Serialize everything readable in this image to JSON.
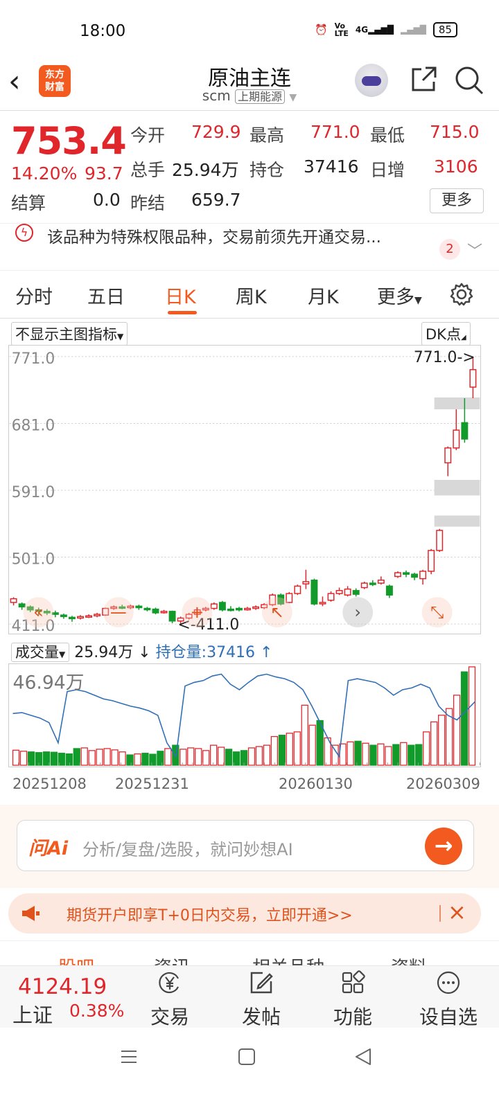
{
  "status_bar": {
    "time": "18:00",
    "battery": "85",
    "network": "4G"
  },
  "header": {
    "logo_line1": "东方",
    "logo_line2": "财富",
    "title": "原油主连",
    "code": "scm",
    "exchange": "上期能源"
  },
  "quote": {
    "price": "753.4",
    "change_pct": "14.20%",
    "change": "93.7",
    "fields": [
      {
        "label": "今开",
        "value": "729.9"
      },
      {
        "label": "最高",
        "value": "771.0"
      },
      {
        "label": "最低",
        "value": "715.0"
      },
      {
        "label": "总手",
        "value": "25.94万"
      },
      {
        "label": "持仓",
        "value": "37416"
      },
      {
        "label": "日增",
        "value": "3106"
      },
      {
        "label": "结算",
        "value": "0.0"
      },
      {
        "label": "昨结",
        "value": "659.7"
      }
    ],
    "more_label": "更多"
  },
  "notice": {
    "text": "该品种为特殊权限品种，交易前须先开通交易...",
    "count": "2"
  },
  "tabs": [
    "分时",
    "五日",
    "日K",
    "周K",
    "月K",
    "更多"
  ],
  "active_tab": "日K",
  "indicator": {
    "main_selector": "不显示主图指标",
    "dk_label": "DK点"
  },
  "volume_header": {
    "selector": "成交量",
    "volume": "25.94万",
    "volume_arrow": "↓",
    "oi": "持仓量:37416",
    "oi_arrow": "↑"
  },
  "chart_data": {
    "type": "candlestick",
    "y_ticks": [
      "771.0",
      "681.0",
      "591.0",
      "501.0",
      "411.0"
    ],
    "ylim": [
      411.0,
      771.0
    ],
    "max_label": "771.0->",
    "min_label": "<-411.0",
    "x_ticks": [
      "20251208",
      "20251231",
      "20260130",
      "20260309"
    ],
    "volume_max_label": "46.94万",
    "candles": [
      {
        "o": 440,
        "c": 445,
        "h": 447,
        "l": 436,
        "up": true
      },
      {
        "o": 438,
        "c": 434,
        "h": 440,
        "l": 430,
        "up": false
      },
      {
        "o": 434,
        "c": 430,
        "h": 436,
        "l": 427,
        "up": false
      },
      {
        "o": 430,
        "c": 428,
        "h": 433,
        "l": 422,
        "up": false
      },
      {
        "o": 428,
        "c": 426,
        "h": 431,
        "l": 423,
        "up": false
      },
      {
        "o": 426,
        "c": 424,
        "h": 429,
        "l": 420,
        "up": false
      },
      {
        "o": 423,
        "c": 421,
        "h": 425,
        "l": 418,
        "up": false
      },
      {
        "o": 420,
        "c": 419,
        "h": 422,
        "l": 414,
        "up": false
      },
      {
        "o": 419,
        "c": 421,
        "h": 423,
        "l": 417,
        "up": true
      },
      {
        "o": 421,
        "c": 422,
        "h": 424,
        "l": 419,
        "up": true
      },
      {
        "o": 422,
        "c": 424,
        "h": 426,
        "l": 420,
        "up": true
      },
      {
        "o": 423,
        "c": 432,
        "h": 433,
        "l": 422,
        "up": true
      },
      {
        "o": 432,
        "c": 434,
        "h": 436,
        "l": 430,
        "up": true
      },
      {
        "o": 434,
        "c": 433,
        "h": 437,
        "l": 431,
        "up": false
      },
      {
        "o": 433,
        "c": 435,
        "h": 437,
        "l": 431,
        "up": true
      },
      {
        "o": 435,
        "c": 433,
        "h": 437,
        "l": 430,
        "up": false
      },
      {
        "o": 432,
        "c": 431,
        "h": 434,
        "l": 428,
        "up": false
      },
      {
        "o": 431,
        "c": 426,
        "h": 433,
        "l": 424,
        "up": false
      },
      {
        "o": 427,
        "c": 428,
        "h": 430,
        "l": 425,
        "up": true
      },
      {
        "o": 428,
        "c": 415,
        "h": 429,
        "l": 412,
        "up": false
      },
      {
        "o": 415,
        "c": 419,
        "h": 421,
        "l": 411,
        "up": true
      },
      {
        "o": 419,
        "c": 424,
        "h": 426,
        "l": 417,
        "up": true
      },
      {
        "o": 424,
        "c": 430,
        "h": 432,
        "l": 422,
        "up": true
      },
      {
        "o": 430,
        "c": 432,
        "h": 434,
        "l": 428,
        "up": true
      },
      {
        "o": 432,
        "c": 438,
        "h": 440,
        "l": 430,
        "up": true
      },
      {
        "o": 440,
        "c": 430,
        "h": 442,
        "l": 428,
        "up": false
      },
      {
        "o": 431,
        "c": 431,
        "h": 435,
        "l": 428,
        "up": false
      },
      {
        "o": 432,
        "c": 430,
        "h": 434,
        "l": 428,
        "up": false
      },
      {
        "o": 431,
        "c": 432,
        "h": 434,
        "l": 429,
        "up": true
      },
      {
        "o": 432,
        "c": 434,
        "h": 436,
        "l": 430,
        "up": true
      },
      {
        "o": 433,
        "c": 437,
        "h": 439,
        "l": 431,
        "up": true
      },
      {
        "o": 437,
        "c": 450,
        "h": 452,
        "l": 435,
        "up": true
      },
      {
        "o": 450,
        "c": 438,
        "h": 452,
        "l": 436,
        "up": false
      },
      {
        "o": 440,
        "c": 452,
        "h": 454,
        "l": 439,
        "up": true
      },
      {
        "o": 452,
        "c": 462,
        "h": 464,
        "l": 450,
        "up": true
      },
      {
        "o": 465,
        "c": 468,
        "h": 484,
        "l": 458,
        "up": true
      },
      {
        "o": 470,
        "c": 438,
        "h": 472,
        "l": 436,
        "up": false
      },
      {
        "o": 440,
        "c": 440,
        "h": 448,
        "l": 435,
        "up": true
      },
      {
        "o": 443,
        "c": 452,
        "h": 455,
        "l": 441,
        "up": true
      },
      {
        "o": 452,
        "c": 456,
        "h": 460,
        "l": 450,
        "up": true
      },
      {
        "o": 450,
        "c": 458,
        "h": 462,
        "l": 448,
        "up": true
      },
      {
        "o": 456,
        "c": 451,
        "h": 459,
        "l": 448,
        "up": false
      },
      {
        "o": 460,
        "c": 466,
        "h": 468,
        "l": 458,
        "up": true
      },
      {
        "o": 466,
        "c": 465,
        "h": 470,
        "l": 462,
        "up": false
      },
      {
        "o": 466,
        "c": 470,
        "h": 475,
        "l": 464,
        "up": true
      },
      {
        "o": 462,
        "c": 450,
        "h": 464,
        "l": 446,
        "up": false
      },
      {
        "o": 475,
        "c": 480,
        "h": 482,
        "l": 473,
        "up": true
      },
      {
        "o": 480,
        "c": 478,
        "h": 483,
        "l": 474,
        "up": false
      },
      {
        "o": 478,
        "c": 474,
        "h": 480,
        "l": 470,
        "up": false
      },
      {
        "o": 472,
        "c": 482,
        "h": 484,
        "l": 464,
        "up": true
      },
      {
        "o": 482,
        "c": 510,
        "h": 512,
        "l": 478,
        "up": true
      },
      {
        "o": 510,
        "c": 537,
        "h": 539,
        "l": 508,
        "up": true
      },
      {
        "o": 628,
        "c": 648,
        "h": 650,
        "l": 610,
        "up": true
      },
      {
        "o": 648,
        "c": 672,
        "h": 700,
        "l": 645,
        "up": true
      },
      {
        "o": 682,
        "c": 660,
        "h": 715,
        "l": 655,
        "up": false
      },
      {
        "o": 729.9,
        "c": 753.4,
        "h": 771.0,
        "l": 715.0,
        "up": true
      }
    ],
    "gaps": [
      {
        "low": 716,
        "high": 700
      },
      {
        "low": 605,
        "high": 584
      },
      {
        "low": 557,
        "high": 542
      }
    ],
    "volumes": [
      0.45,
      0.42,
      0.4,
      0.38,
      0.4,
      0.39,
      0.36,
      0.34,
      0.5,
      0.52,
      0.44,
      0.48,
      0.5,
      0.46,
      0.4,
      0.31,
      0.34,
      0.36,
      0.33,
      0.42,
      0.5,
      0.6,
      0.48,
      0.52,
      0.5,
      0.44,
      0.6,
      0.54,
      0.48,
      0.4,
      0.44,
      0.52,
      0.56,
      0.6,
      0.86,
      0.9,
      0.96,
      1.0,
      1.8,
      1.2,
      1.34,
      0.82,
      0.6,
      0.64,
      0.7,
      0.72,
      0.66,
      0.6,
      0.64,
      0.56,
      0.62,
      0.68,
      0.6,
      0.62,
      1.0,
      1.3,
      1.5,
      1.7,
      2.1,
      2.8,
      2.95
    ],
    "open_interest": [
      0.52,
      0.53,
      0.5,
      0.47,
      0.42,
      0.2,
      0.76,
      0.78,
      0.76,
      0.72,
      0.68,
      0.66,
      0.63,
      0.6,
      0.58,
      0.55,
      0.5,
      0.2,
      0.05,
      0.82,
      0.86,
      0.88,
      0.93,
      0.95,
      0.84,
      0.78,
      0.86,
      0.93,
      0.95,
      0.92,
      0.9,
      0.86,
      0.78,
      0.6,
      0.4,
      0.2,
      0.05,
      0.88,
      0.9,
      0.88,
      0.86,
      0.8,
      0.72,
      0.78,
      0.8,
      0.84,
      0.8,
      0.6,
      0.5,
      0.45,
      0.55,
      0.65
    ]
  },
  "ai": {
    "logo": "问Ai",
    "placeholder": "分析/复盘/选股，就问妙想AI"
  },
  "banner": {
    "text": "期货开户即享T+0日内交易，立即开通>>"
  },
  "low_tabs": [
    "股吧",
    "资讯",
    "相关品种",
    "资料"
  ],
  "index": {
    "value": "4124.19",
    "name": "上证",
    "pct": "0.38%"
  },
  "bottom_items": [
    {
      "label": "交易",
      "icon": "yen-circle-icon"
    },
    {
      "label": "发帖",
      "icon": "edit-icon"
    },
    {
      "label": "功能",
      "icon": "grid-icon"
    },
    {
      "label": "设自选",
      "icon": "more-circle-icon"
    }
  ],
  "colors": {
    "up": "#e0262b",
    "down": "#119b2a",
    "accent": "#f25a1f",
    "oi_line": "#2f6fb6"
  }
}
